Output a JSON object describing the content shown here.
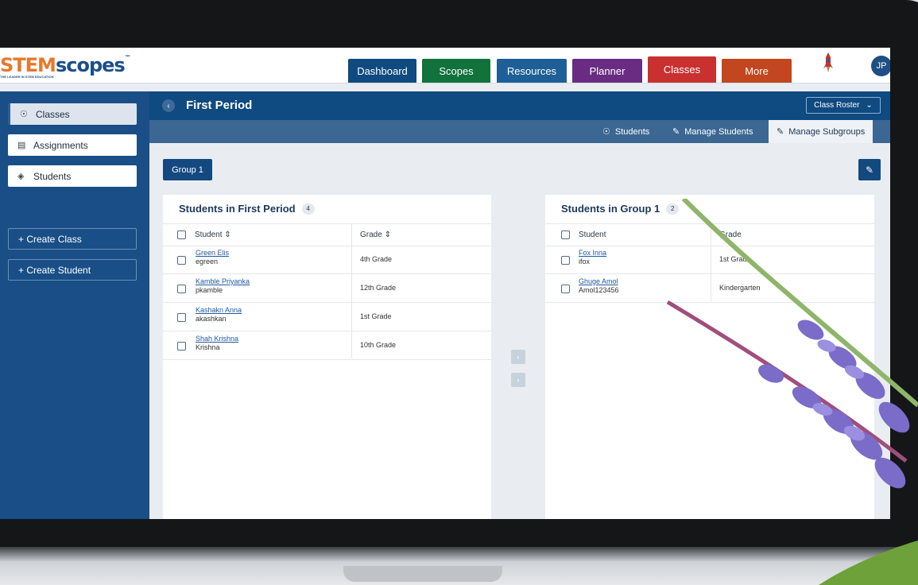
{
  "brand": {
    "logo_prefix": "STEM",
    "logo_suffix": "scopes",
    "tm": "™",
    "tagline": "THE LEADER IN STEM EDUCATION"
  },
  "nav": [
    {
      "label": "Dashboard",
      "color": "#0f4a80"
    },
    {
      "label": "Scopes",
      "color": "#11723c"
    },
    {
      "label": "Resources",
      "color": "#1d5f96"
    },
    {
      "label": "Planner",
      "color": "#6a2c82"
    },
    {
      "label": "Classes",
      "color": "#c8312f"
    },
    {
      "label": "More",
      "color": "#c2461f"
    }
  ],
  "user": {
    "initials": "JP"
  },
  "sidebar": {
    "items": [
      {
        "label": "Classes",
        "icon": "users-icon"
      },
      {
        "label": "Assignments",
        "icon": "clipboard-icon"
      },
      {
        "label": "Students",
        "icon": "graduation-cap-icon"
      }
    ],
    "actions": [
      {
        "label": "+ Create Class"
      },
      {
        "label": "+ Create Student"
      }
    ]
  },
  "page": {
    "title": "First Period",
    "roster_label": "Class Roster"
  },
  "tabs": [
    {
      "label": "Students",
      "icon": "user-icon"
    },
    {
      "label": "Manage Students",
      "icon": "user-edit-icon"
    },
    {
      "label": "Manage Subgroups",
      "icon": "users-edit-icon"
    }
  ],
  "group": {
    "label": "Group 1"
  },
  "left_panel": {
    "title": "Students in First Period",
    "count": "4",
    "col_student": "Student",
    "col_grade": "Grade",
    "rows": [
      {
        "name": "Green Elis",
        "username": "egreen",
        "grade": "4th Grade"
      },
      {
        "name": "Kamble Priyanka",
        "username": "pkamble",
        "grade": "12th Grade"
      },
      {
        "name": "Kashakn Anna",
        "username": "akashkan",
        "grade": "1st Grade"
      },
      {
        "name": "Shah Krishna",
        "username": "Krishna",
        "grade": "10th Grade"
      }
    ]
  },
  "right_panel": {
    "title": "Students in Group 1",
    "count": "2",
    "col_student": "Student",
    "col_grade": "Grade",
    "rows": [
      {
        "name": "Fox Inna",
        "username": "ifox",
        "grade": "1st Grade"
      },
      {
        "name": "Ghuge Amol",
        "username": "Amol123456",
        "grade": "Kindergarten"
      }
    ]
  },
  "transfer": {
    "left_arrow": "‹",
    "right_arrow": "›"
  }
}
